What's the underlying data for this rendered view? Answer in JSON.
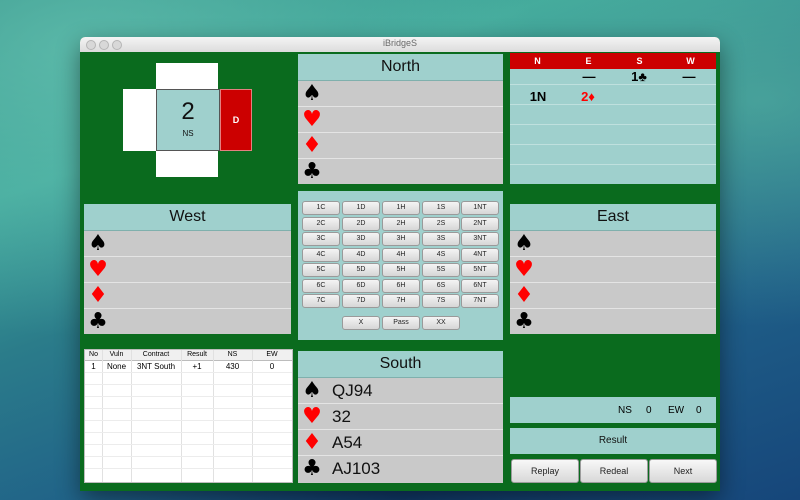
{
  "window": {
    "title": "iBridgeS"
  },
  "dealer_box": {
    "board_number": "2",
    "vulnerability": "NS",
    "dealer_label": "D"
  },
  "hands": {
    "north": {
      "label": "North",
      "spades": "",
      "hearts": "",
      "diamonds": "",
      "clubs": ""
    },
    "west": {
      "label": "West",
      "spades": "",
      "hearts": "",
      "diamonds": "",
      "clubs": ""
    },
    "east": {
      "label": "East",
      "spades": "",
      "hearts": "",
      "diamonds": "",
      "clubs": ""
    },
    "south": {
      "label": "South",
      "spades": "QJ94",
      "hearts": "32",
      "diamonds": "A54",
      "clubs": "AJ103"
    }
  },
  "suit_symbols": {
    "spades": "♠",
    "hearts": "♥",
    "diamonds": "♦",
    "clubs": "♣"
  },
  "auction": {
    "headers": [
      "N",
      "E",
      "S",
      "W"
    ],
    "row1": {
      "N": "",
      "E": "—",
      "S": "1♣",
      "W": "—"
    },
    "row2": {
      "N": "1N",
      "E": "2♦",
      "S": "",
      "W": ""
    }
  },
  "bidding_box": {
    "rows": [
      [
        "1C",
        "1D",
        "1H",
        "1S",
        "1NT"
      ],
      [
        "2C",
        "2D",
        "2H",
        "2S",
        "2NT"
      ],
      [
        "3C",
        "3D",
        "3H",
        "3S",
        "3NT"
      ],
      [
        "4C",
        "4D",
        "4H",
        "4S",
        "4NT"
      ],
      [
        "5C",
        "5D",
        "5H",
        "5S",
        "5NT"
      ],
      [
        "6C",
        "6D",
        "6H",
        "6S",
        "6NT"
      ],
      [
        "7C",
        "7D",
        "7H",
        "7S",
        "7NT"
      ]
    ],
    "specials": [
      "X",
      "Pass",
      "XX"
    ]
  },
  "score_table": {
    "headers": [
      "No",
      "Vuln",
      "Contract",
      "Result",
      "NS",
      "EW"
    ],
    "rows": [
      [
        "1",
        "None",
        "3NT South",
        "+1",
        "430",
        "0"
      ]
    ]
  },
  "score": {
    "ns_label": "NS",
    "ns_value": "0",
    "ew_label": "EW",
    "ew_value": "0"
  },
  "result_label": "Result",
  "actions": {
    "replay": "Replay",
    "redeal": "Redeal",
    "next": "Next"
  },
  "colors": {
    "felt": "#0a6b1e",
    "panel": "#9fd0cd",
    "red": "#cc0000"
  }
}
